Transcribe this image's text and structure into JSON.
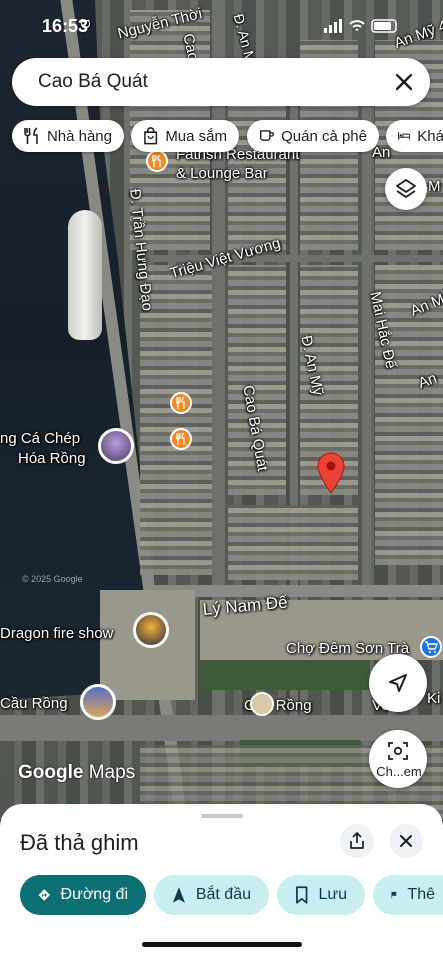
{
  "status_bar": {
    "time": "16:53"
  },
  "search": {
    "query": "Cao Bá Quát"
  },
  "chips": [
    {
      "label": "Nhà hàng",
      "icon": "fork-knife-icon"
    },
    {
      "label": "Mua sắm",
      "icon": "shopping-bag-icon"
    },
    {
      "label": "Quán cà phê",
      "icon": "coffee-icon"
    },
    {
      "label": "Khá",
      "icon": "bed-icon"
    }
  ],
  "map": {
    "labels": {
      "nguyen_thoi": "Nguyễn Thời",
      "cao_top": "Cao",
      "dan_my_top": "Đ. An Mỹ",
      "an_my_4": "An Mỹ 4",
      "restaurant": "Fathsh Restaurant",
      "lounge": "& Lounge Bar",
      "an_right_top": "An",
      "m_right": "M",
      "tran_hung_dao": "Đ. Trần Hưng Đạo",
      "trieu_viet_vuong": "Triệu Việt Vương",
      "an_m": "An M",
      "mai_hac_de": "Mai Hắc Đế",
      "an": "An",
      "dan_my": "Đ. An Mỹ",
      "cao_ba_quat": "Cao Bá Quát",
      "ca_chep_1": "ng Cá Chép",
      "ca_chep_2": "Hóa Rồng",
      "ly_nam_de": "Lý Nam Đế",
      "dragon_fire": "Dragon fire show",
      "cho_dem": "Chợ Đêm Sơn Trà",
      "cau_rong": "Cầu Rồng",
      "cau_rong_bridge": "Cầu Rồng",
      "ve": "Vo",
      "ki": "Ki",
      "copyright": "© 2025 Google"
    },
    "watermark_a": "Google",
    "watermark_b": "Maps",
    "lens_label": "Ch...em"
  },
  "sheet": {
    "title": "Đã thả ghim",
    "actions": [
      {
        "label": "Đường đi",
        "icon": "directions-icon"
      },
      {
        "label": "Bắt đầu",
        "icon": "navigation-arrow-icon"
      },
      {
        "label": "Lưu",
        "icon": "bookmark-icon"
      },
      {
        "label": "Thê",
        "icon": "flag-icon"
      }
    ]
  },
  "colors": {
    "primary": "#0d6e73",
    "secondary": "#c8eef2",
    "pin": "#ea4335",
    "poi_food": "#f08a24"
  }
}
